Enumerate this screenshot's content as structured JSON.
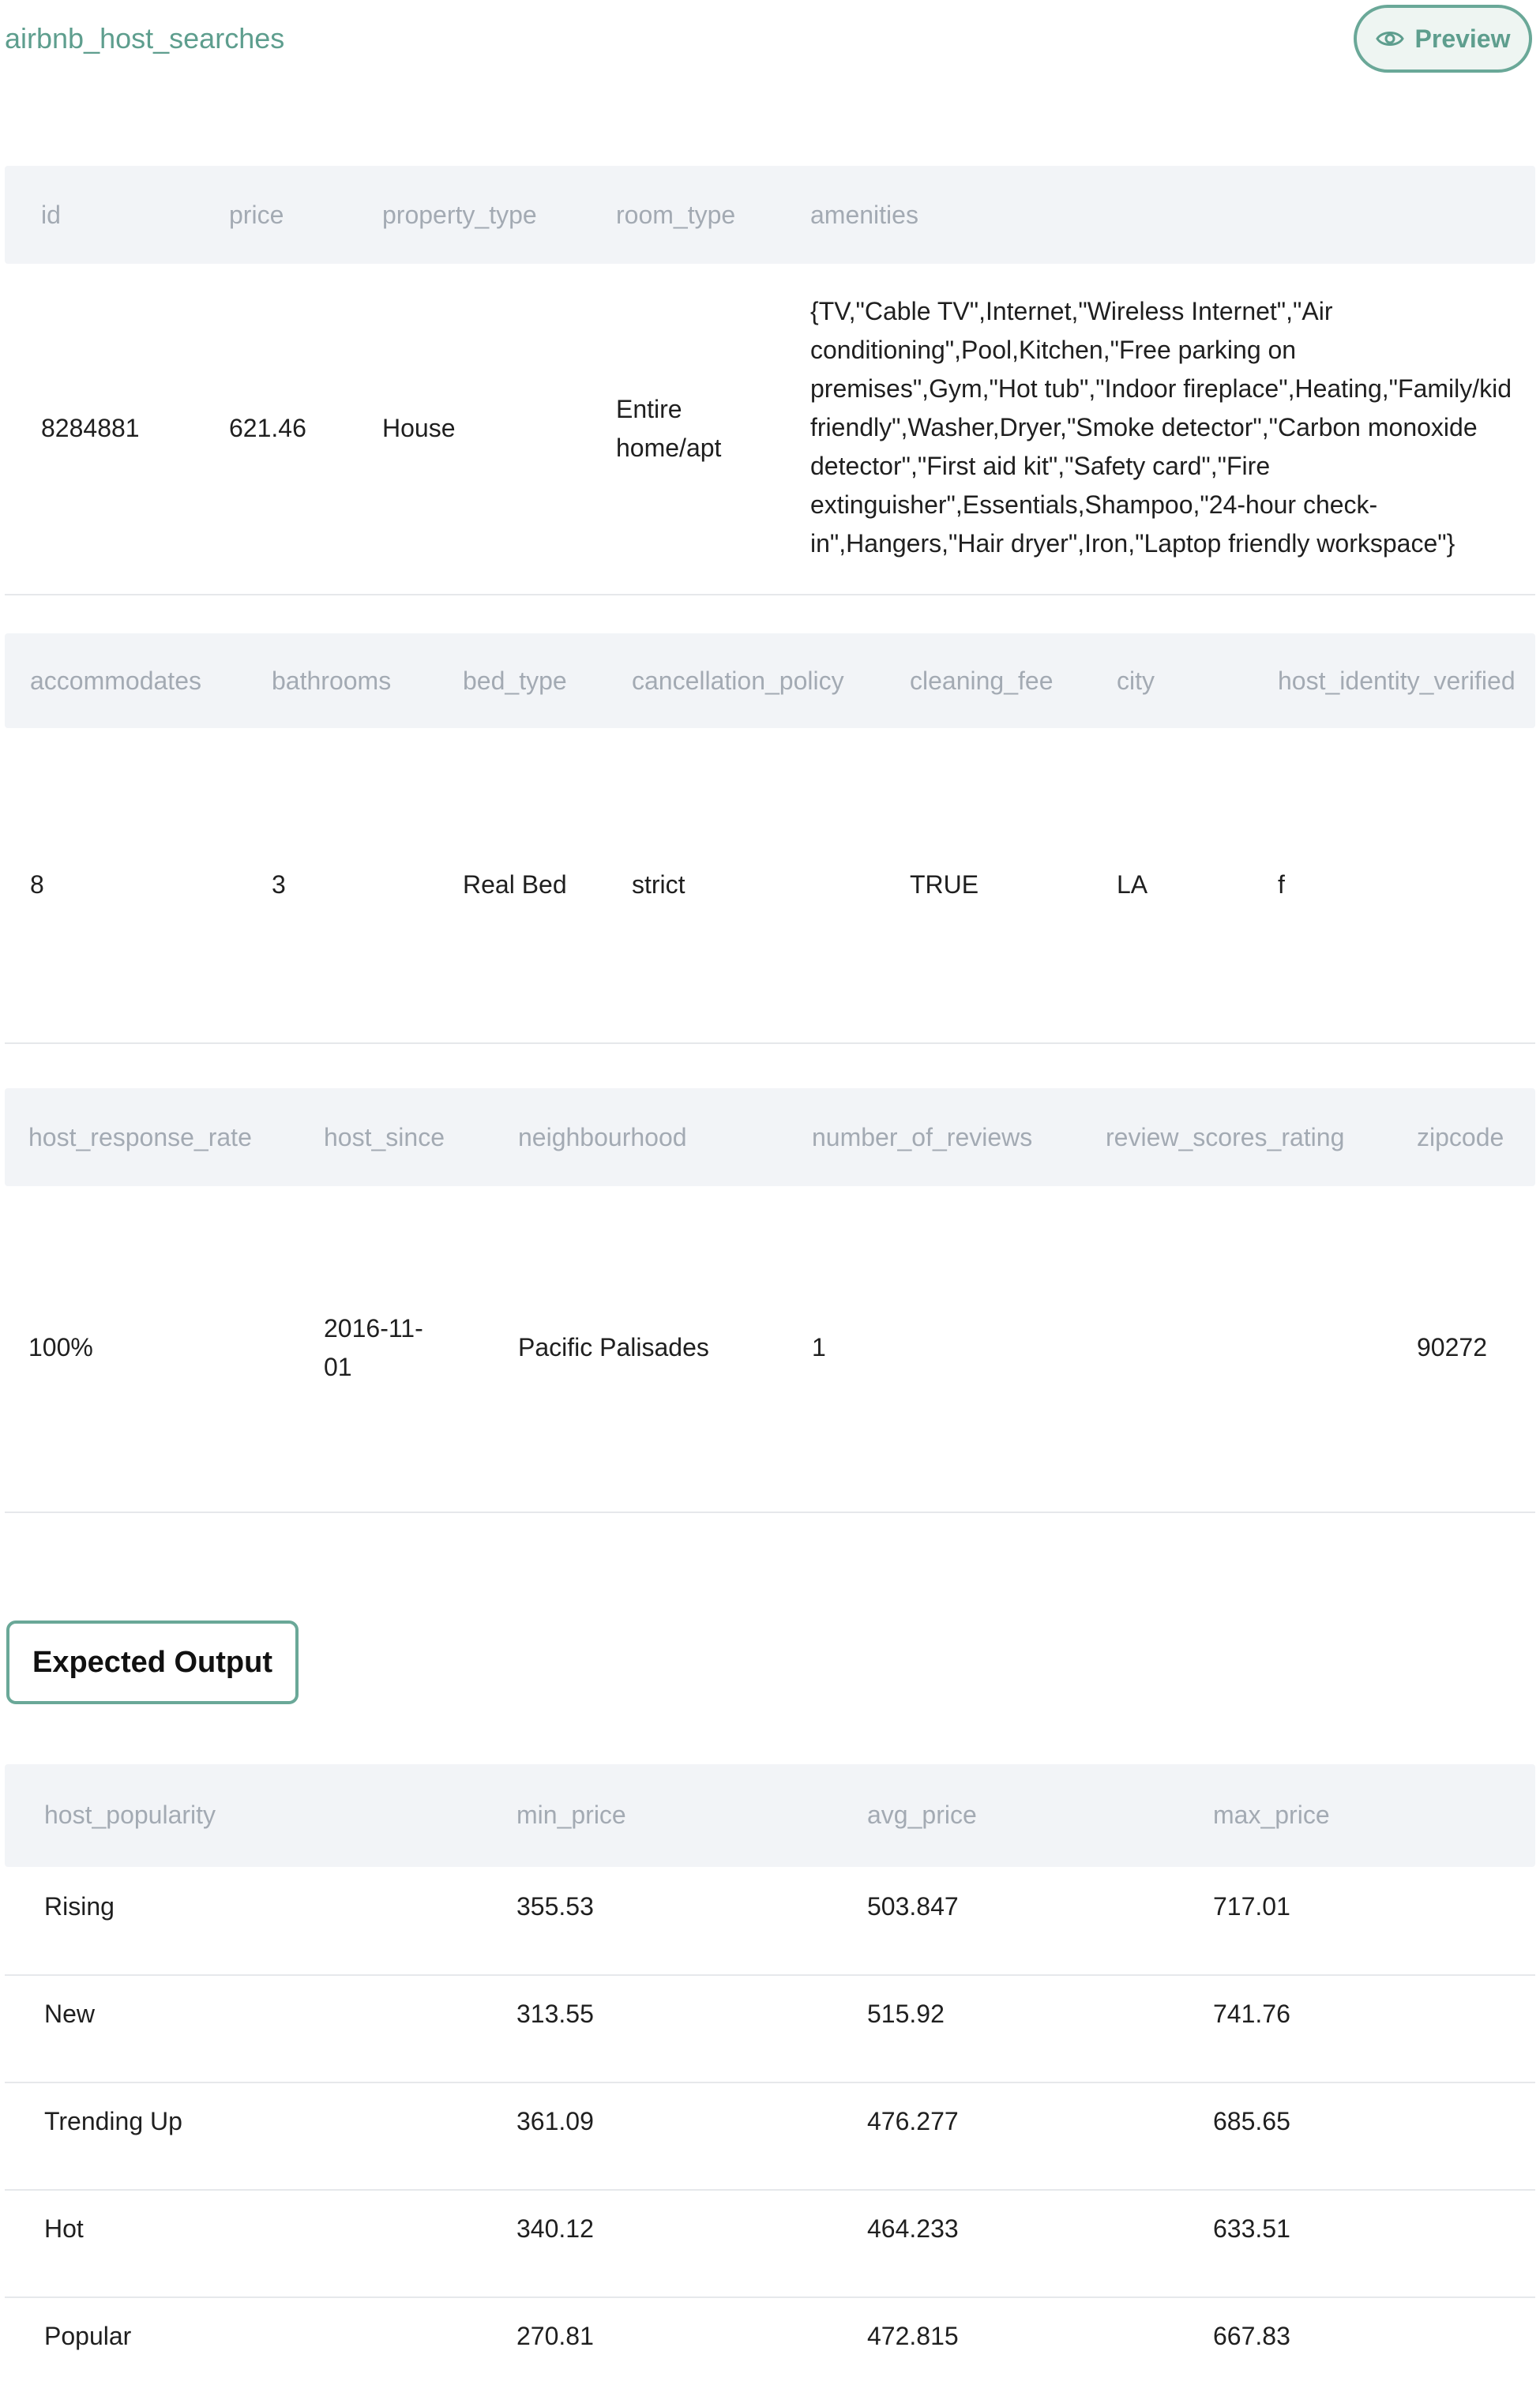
{
  "header": {
    "table_name": "airbnb_host_searches",
    "preview_label": "Preview",
    "preview_icon": "eye-icon"
  },
  "input_table_1": {
    "columns": [
      "id",
      "price",
      "property_type",
      "room_type",
      "amenities"
    ],
    "row": {
      "id": "8284881",
      "price": "621.46",
      "property_type": "House",
      "room_type_line1": "Entire",
      "room_type_line2": "home/apt",
      "amenities_lines": [
        "{TV,\"Cable TV\",Internet,\"Wireless Internet\",\"Air",
        "conditioning\",Pool,Kitchen,\"Free parking on",
        "premises\",Gym,\"Hot tub\",\"Indoor fireplace\",Heating,\"Family/kid",
        "friendly\",Washer,Dryer,\"Smoke detector\",\"Carbon monoxide",
        "detector\",\"First aid kit\",\"Safety card\",\"Fire",
        "extinguisher\",Essentials,Shampoo,\"24-hour check-",
        "in\",Hangers,\"Hair dryer\",Iron,\"Laptop friendly workspace\"}"
      ]
    }
  },
  "input_table_2": {
    "columns": [
      "accommodates",
      "bathrooms",
      "bed_type",
      "cancellation_policy",
      "cleaning_fee",
      "city",
      "host_identity_verified"
    ],
    "row": [
      "8",
      "3",
      "Real Bed",
      "strict",
      "TRUE",
      "LA",
      "f"
    ]
  },
  "input_table_3": {
    "columns": [
      "host_response_rate",
      "host_since",
      "neighbourhood",
      "number_of_reviews",
      "review_scores_rating",
      "zipcode"
    ],
    "row": {
      "host_response_rate": "100%",
      "host_since_line1": "2016-11-",
      "host_since_line2": "01",
      "neighbourhood": "Pacific Palisades",
      "number_of_reviews": "1",
      "review_scores_rating": "",
      "zipcode": "90272"
    }
  },
  "expected_output": {
    "label": "Expected Output",
    "columns": [
      "host_popularity",
      "min_price",
      "avg_price",
      "max_price"
    ],
    "rows": [
      [
        "Rising",
        "355.53",
        "503.847",
        "717.01"
      ],
      [
        "New",
        "313.55",
        "515.92",
        "741.76"
      ],
      [
        "Trending Up",
        "361.09",
        "476.277",
        "685.65"
      ],
      [
        "Hot",
        "340.12",
        "464.233",
        "633.51"
      ],
      [
        "Popular",
        "270.81",
        "472.815",
        "667.83"
      ]
    ]
  }
}
